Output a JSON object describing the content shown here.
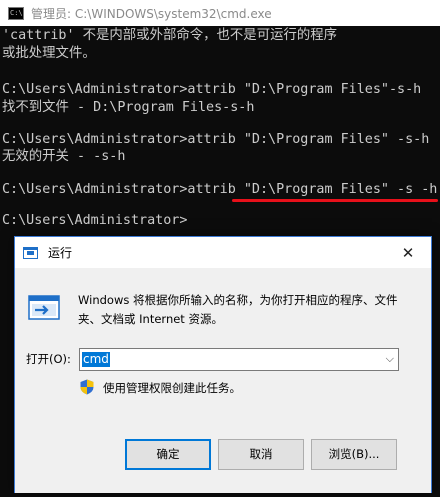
{
  "console": {
    "title": "管理员: C:\\WINDOWS\\system32\\cmd.exe",
    "lines": [
      "'cattrib' 不是内部或外部命令，也不是可运行的程序",
      "或批处理文件。",
      "",
      "C:\\Users\\Administrator>attrib \"D:\\Program Files\"-s-h",
      "找不到文件 - D:\\Program Files-s-h",
      "",
      "C:\\Users\\Administrator>attrib \"D:\\Program Files\" -s-h",
      "无效的开关 - -s-h",
      "",
      "C:\\Users\\Administrator>attrib \"D:\\Program Files\" -s -h",
      "",
      "C:\\Users\\Administrator>"
    ],
    "annotation_color": "#e8101a"
  },
  "run_dialog": {
    "title": "运行",
    "close_glyph": "✕",
    "description": "Windows 将根据你所输入的名称，为你打开相应的程序、文件夹、文档或 Internet 资源。",
    "open_label": "打开(O):",
    "open_value": "cmd",
    "admin_note": "使用管理权限创建此任务。",
    "buttons": {
      "ok": "确定",
      "cancel": "取消",
      "browse": "浏览(B)..."
    }
  }
}
